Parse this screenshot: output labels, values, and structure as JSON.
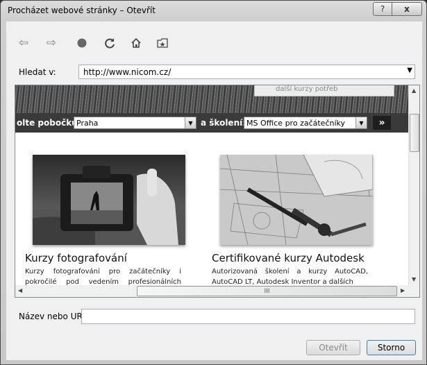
{
  "window": {
    "title": "Procházet webové stránky – Otevřít",
    "help_label": "?",
    "close_label": "x"
  },
  "toolbar": {
    "icons": [
      "back-arrow-icon",
      "forward-arrow-icon",
      "stop-icon",
      "refresh-icon",
      "home-icon",
      "favorites-icon"
    ]
  },
  "search": {
    "label": "Hledat v:",
    "value": "http://www.nicom.cz/"
  },
  "page": {
    "top_card_text": "další kurzy potřeb",
    "filter": {
      "branch_label": "olte pobočku:",
      "branch_value": "Praha",
      "training_label": "a školení:",
      "training_value": "MS Office pro začátečníky",
      "go_label": "»"
    },
    "cards": [
      {
        "title": "Kurzy fotografování",
        "description": "Kurzy fotografování pro začátečníky i pokročilé pod vedením profesionálních fotografů."
      },
      {
        "title": "Certifikované kurzy Autodesk",
        "description": "Autorizovaná školení a kurzy AutoCAD, AutoCAD LT, Autodesk Inventor a dalších"
      }
    ],
    "hscroll_grip": "III"
  },
  "url": {
    "label": "Název nebo URL:",
    "value": ""
  },
  "buttons": {
    "open_label": "Otevřít",
    "cancel_label": "Storno"
  },
  "colors": {
    "filter_bar": "#3a3a3a",
    "window_frame": "#cfcfcf"
  }
}
